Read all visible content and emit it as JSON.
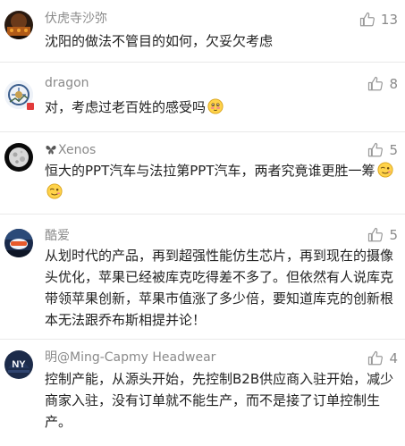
{
  "comments": [
    {
      "username": "伏虎寺沙弥",
      "likes": "13",
      "text": "沈阳的做法不管目的如何，欠妥欠考虑"
    },
    {
      "username": "dragon",
      "likes": "8",
      "text": "对，考虑过老百姓的感受吗"
    },
    {
      "username": "Xenos",
      "likes": "5",
      "text": "恒大的PPT汽车与法拉第PPT汽车，两者究竟谁更胜一筹"
    },
    {
      "username": "酷爱",
      "likes": "5",
      "text": "从划时代的产品，再到超强性能仿生芯片，再到现在的摄像头优化，苹果已经被库克吃得差不多了。但依然有人说库克带领苹果创新，苹果市值涨了多少倍，要知道库克的创新根本无法跟乔布斯相提并论！"
    },
    {
      "username": "明@Ming-Capmy Headwear",
      "likes": "4",
      "text": "控制产能，从源头开始，先控制B2B供应商入驻开始，减少商家入驻，没有订单就不能生产，而不是接了订单控制生产。"
    }
  ],
  "icons": {
    "like": "thumbs-up-icon",
    "emoji_blush": "blushing-face-icon",
    "emoji_wink": "winking-face-icon"
  },
  "colors": {
    "username": "#8a8a8a",
    "text": "#222222",
    "icon": "#9a9a9a",
    "divider": "#e9e9e9"
  }
}
